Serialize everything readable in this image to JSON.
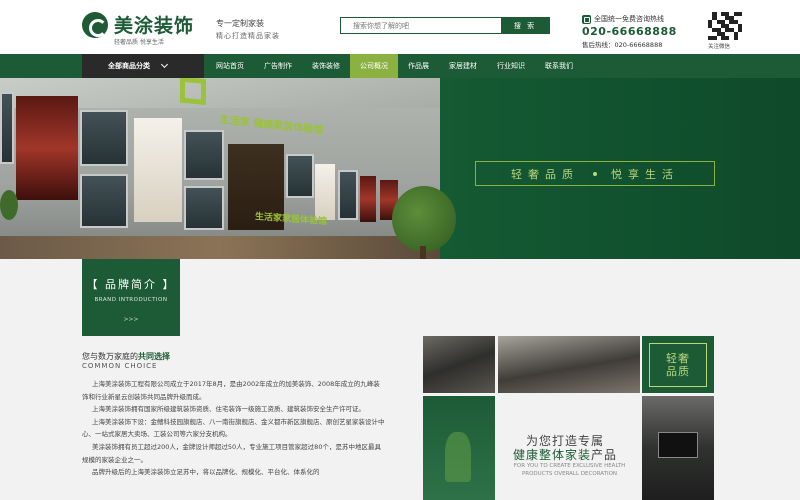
{
  "header": {
    "logo_name": "美涂装饰",
    "logo_sub": "轻奢品质 悦享生活",
    "slogan": "专一定制家装",
    "slogan2": "精心打造精品家装",
    "search_placeholder": "搜索你想了解的吧",
    "search_button": "搜 索",
    "hotline_title": "全国统一免费咨询热线",
    "hotline_number": "020-66668888",
    "hotline_sub": "售后热线：020-66668888",
    "qr_label": "关注微信"
  },
  "nav": {
    "category_label": "全部商品分类",
    "items": [
      {
        "label": "网站首页",
        "active": false
      },
      {
        "label": "广告制作",
        "active": false
      },
      {
        "label": "装饰装修",
        "active": false
      },
      {
        "label": "公司概况",
        "active": true
      },
      {
        "label": "作品展",
        "active": false
      },
      {
        "label": "家居建材",
        "active": false
      },
      {
        "label": "行业知识",
        "active": false
      },
      {
        "label": "联系我们",
        "active": false
      }
    ]
  },
  "banner": {
    "sign_text": "生活家 健康家居体验馆",
    "sign_text2": "生活家家居体验馆",
    "tagline_left": "轻奢品质",
    "tagline_right": "悦享生活"
  },
  "brand": {
    "title": "【 品牌简介 】",
    "en": "BRAND INTRODUCTION",
    "more": ">>>"
  },
  "intro": {
    "heading_pre": "您与数万家庭的",
    "heading_em": "共同选择",
    "heading_en": "COMMON CHOICE",
    "paragraphs": [
      "上海美涂装饰工程有限公司成立于2017年8月，是由2002年成立的加美装饰、2008年成立的九峰装饰和行业新星云创装饰共同品牌升级而成。",
      "上海美涂装饰拥有国家所级建筑装饰资质、住宅装饰一级施工资质、建筑装饰安全生产许可证。",
      "上海美涂装饰下设：金鳍科技园旗舰店、八一南街旗舰店、金义都市新区旗舰店、原创艺星家装设计中心、一站式家居大卖场、工装公司等六家分支机构。",
      "美涂装饰拥有员工超过200人，金牌设计师超过50人，专业施工项目管家超过80个，是苏中地区最具规模的家装企业之一。",
      "品牌升级后的上海美涂装饰立足苏中，将以品牌化、规模化、平台化、体系化的"
    ]
  },
  "gallery": {
    "green_tile_text": "轻奢\n品质",
    "promo_line1": "为您打造专属",
    "promo_line2_em": "健康整体家装",
    "promo_line2_tail": "产品",
    "promo_en": "FOR YOU TO CREATE EXCLUSIVE HEALTH PRODUCTS OVERALL DECORATION"
  }
}
